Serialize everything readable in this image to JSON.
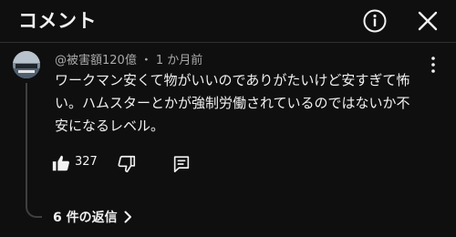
{
  "header": {
    "title": "コメント",
    "info_icon": "info-circle-icon",
    "close_icon": "close-icon"
  },
  "comment": {
    "author": "@被害額120億",
    "separator": "・",
    "time": "1 か月前",
    "text": "ワークマン安くて物がいいのでありがたいけど安すぎて怖い。ハムスターとかが強制労働されているのではないか不安になるレベル。",
    "like_count": "327",
    "replies_label": "6 件の返信",
    "icons": [
      "thumbs-up-icon",
      "thumbs-down-icon",
      "reply-icon",
      "more-vert-icon",
      "chevron-right-icon"
    ]
  },
  "colors": {
    "background": "#0f0f0f",
    "text": "#f1f1f1",
    "meta": "#aaaaaa"
  }
}
